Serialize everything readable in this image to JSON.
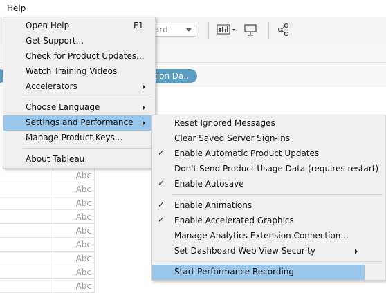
{
  "menubar": {
    "help_label": "Help"
  },
  "toolbar": {
    "dropdown_text": "ard"
  },
  "pill": {
    "label": "tion Da.."
  },
  "grid": {
    "cells": [
      "Abc",
      "Abc",
      "Abc",
      "Abc",
      "Abc",
      "Abc",
      "Abc",
      "Abc",
      "Abc"
    ]
  },
  "help_menu": {
    "items": [
      {
        "label": "Open Help",
        "shortcut": "F1"
      },
      {
        "label": "Get Support..."
      },
      {
        "label": "Check for Product Updates..."
      },
      {
        "label": "Watch Training Videos"
      },
      {
        "label": "Accelerators"
      },
      {
        "label": "Choose Language"
      },
      {
        "label": "Settings and Performance"
      },
      {
        "label": "Manage Product Keys..."
      },
      {
        "label": "About Tableau"
      }
    ]
  },
  "settings_menu": {
    "items": [
      {
        "label": "Reset Ignored Messages",
        "checked": false
      },
      {
        "label": "Clear Saved Server Sign-ins",
        "checked": false
      },
      {
        "label": "Enable Automatic Product Updates",
        "checked": true
      },
      {
        "label": "Don't Send Product Usage Data (requires restart)",
        "checked": false
      },
      {
        "label": "Enable Autosave",
        "checked": true
      },
      {
        "label": "Enable Animations",
        "checked": true
      },
      {
        "label": "Enable Accelerated Graphics",
        "checked": true
      },
      {
        "label": "Manage Analytics Extension Connection...",
        "checked": false
      },
      {
        "label": "Set Dashboard Web View Security",
        "checked": false
      },
      {
        "label": "Start Performance Recording",
        "checked": false
      }
    ]
  },
  "colors": {
    "highlight": "#99c7ec",
    "menu_bg": "#f0f0f0",
    "pill": "#5a9ec2"
  },
  "icons": [
    "bar-chart-icon",
    "presentation-icon",
    "share-icon",
    "check-icon",
    "submenu-arrow-icon"
  ]
}
